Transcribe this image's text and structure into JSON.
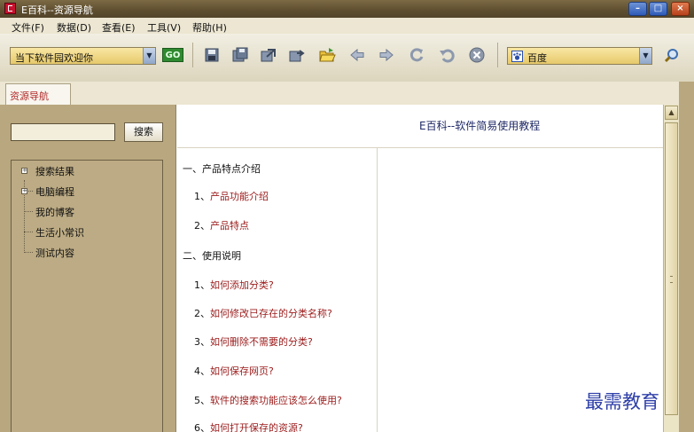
{
  "window": {
    "title": "E百科--资源导航"
  },
  "menu": [
    "文件(F)",
    "数据(D)",
    "查看(E)",
    "工具(V)",
    "帮助(H)"
  ],
  "toolbar": {
    "address_value": "当下软件园欢迎你",
    "go_label": "GO",
    "search_engine": "百度"
  },
  "tabs": [
    {
      "label": "资源导航"
    }
  ],
  "left": {
    "search_label": "搜索",
    "tree": [
      "搜索结果",
      "电脑编程",
      "我的博客",
      "生活小常识",
      "测试内容"
    ]
  },
  "content": {
    "title": "E百科--软件简易使用教程",
    "section1": "一、产品特点介绍",
    "items1": [
      {
        "num": "1、",
        "text": "产品功能介绍"
      },
      {
        "num": "2、",
        "text": "产品特点"
      }
    ],
    "section2": "二、使用说明",
    "items2": [
      {
        "num": "1、",
        "text": "如何添加分类?"
      },
      {
        "num": "2、",
        "text": "如何修改已存在的分类名称?"
      },
      {
        "num": "3、",
        "text": "如何删除不需要的分类?"
      },
      {
        "num": "4、",
        "text": "如何保存网页?"
      },
      {
        "num": "5、",
        "text": "软件的搜索功能应该怎么使用?"
      },
      {
        "num": "6、",
        "text": "如何打开保存的资源?"
      }
    ]
  },
  "watermark": "最需教育",
  "colors": {
    "titlebar": "#5e4e2f",
    "panel": "#b9a77f",
    "link": "#9b1b1b",
    "combo": "#f0d98a"
  }
}
